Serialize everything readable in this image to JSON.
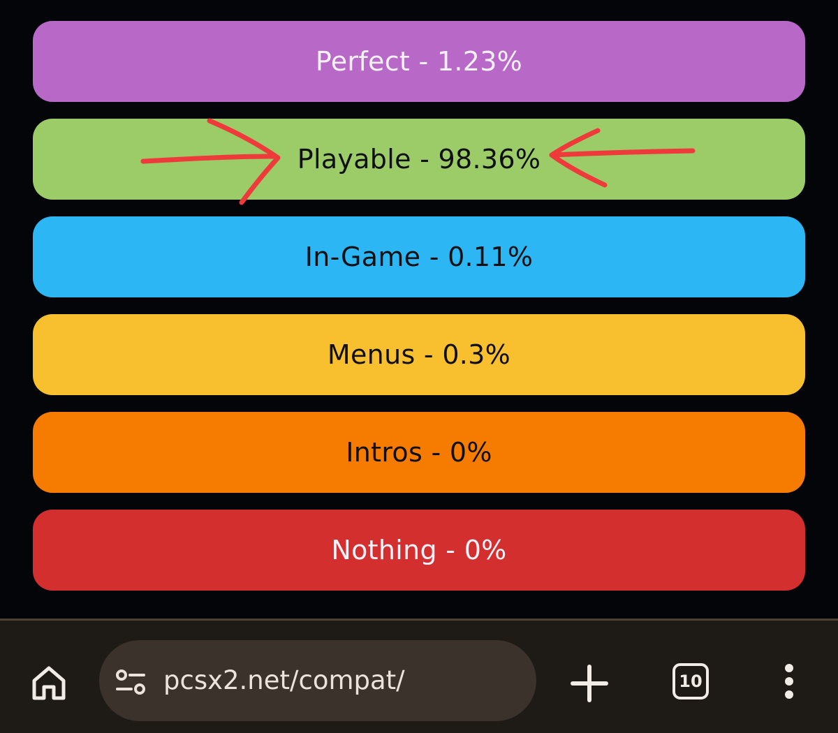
{
  "statuses": [
    {
      "label": "Perfect - 1.23%",
      "color": "#b868c6",
      "text_color": "light"
    },
    {
      "label": "Playable - 98.36%",
      "color": "#9ccc68",
      "text_color": "dark"
    },
    {
      "label": "In-Game - 0.11%",
      "color": "#2db6f4",
      "text_color": "dark"
    },
    {
      "label": "Menus - 0.3%",
      "color": "#f8c02e",
      "text_color": "dark"
    },
    {
      "label": "Intros - 0%",
      "color": "#f57c00",
      "text_color": "dark"
    },
    {
      "label": "Nothing - 0%",
      "color": "#d32f2f",
      "text_color": "light"
    }
  ],
  "annotation": {
    "color": "#ee3a3a",
    "icon": "red-hand-drawn-arrows"
  },
  "browser": {
    "url": "pcsx2.net/compat/",
    "tab_count": "10",
    "icons": [
      "home-icon",
      "site-settings-icon",
      "plus-icon",
      "tab-switcher-icon",
      "more-vert-icon"
    ]
  }
}
